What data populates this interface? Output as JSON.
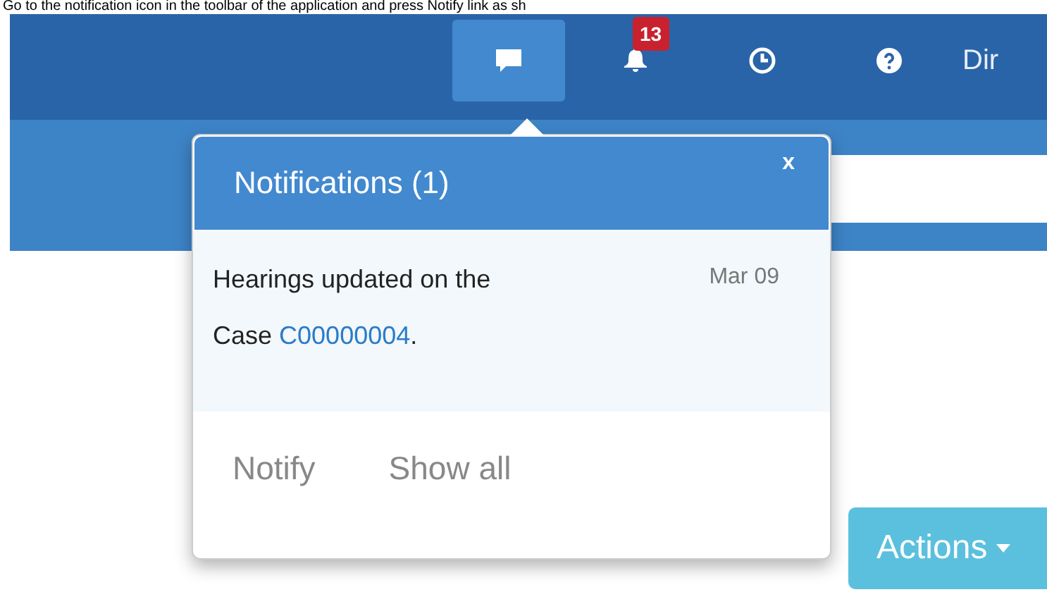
{
  "caption": "Go to the notification icon in the toolbar of the application and press Notify link as sh",
  "toolbar": {
    "items": [
      {
        "kind": "chat",
        "selected": true
      },
      {
        "kind": "bell",
        "selected": false,
        "badge": "13"
      },
      {
        "kind": "clock",
        "selected": false
      },
      {
        "kind": "help",
        "selected": false
      }
    ],
    "user": "Dir"
  },
  "notifications": {
    "title": "Notifications (1)",
    "close": "x",
    "items": [
      {
        "text_before": "Hearings updated on the Case",
        "link": "C00000004",
        "text_after": ".",
        "date": "Mar 09"
      }
    ],
    "links": [
      "Notify",
      "Show all"
    ]
  },
  "actions_button": "Actions"
}
